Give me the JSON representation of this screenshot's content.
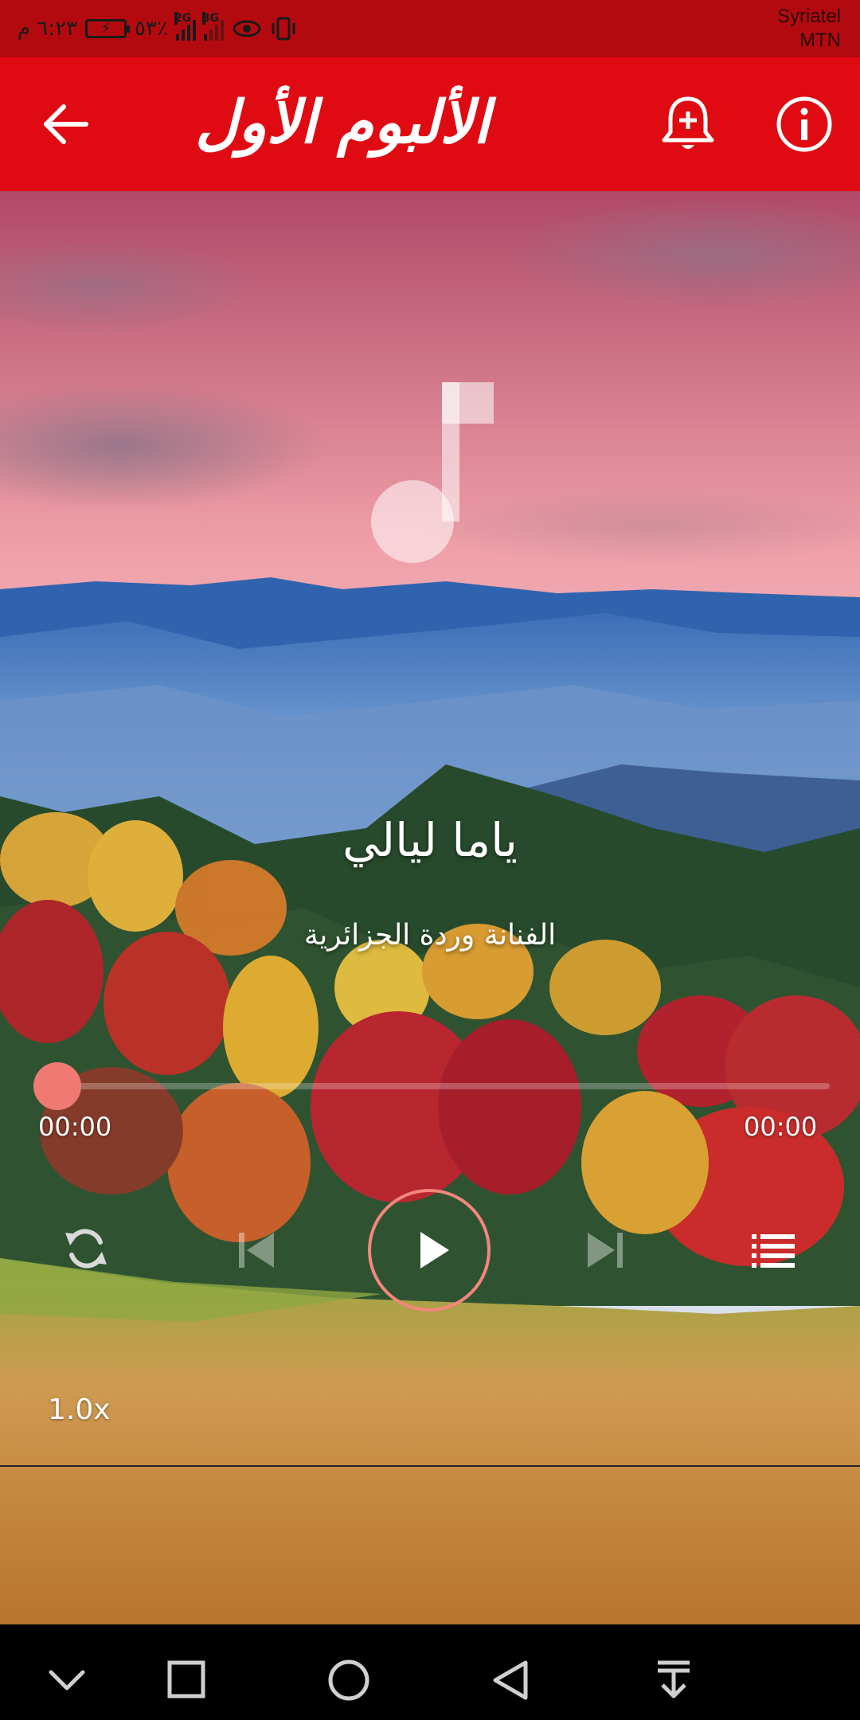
{
  "status_bar": {
    "time": "٦:٢٣ م",
    "battery_percent": "٥٣٪",
    "network_1": "2G",
    "network_2": "3G",
    "carrier_1": "Syriatel",
    "carrier_2": "MTN"
  },
  "app_bar": {
    "title": "الألبوم الأول",
    "back_icon": "arrow-left-icon",
    "notify_icon": "bell-plus-icon",
    "info_icon": "info-circle-icon"
  },
  "player": {
    "song_title": "ياما ليالي",
    "artist": "الفنانة وردة الجزائرية",
    "elapsed": "00:00",
    "total": "00:00",
    "progress": 0,
    "speed": "1.0x",
    "accent_color": "#f07a72"
  },
  "colors": {
    "status_bar": "#b30a10",
    "app_bar": "#e00b12"
  }
}
